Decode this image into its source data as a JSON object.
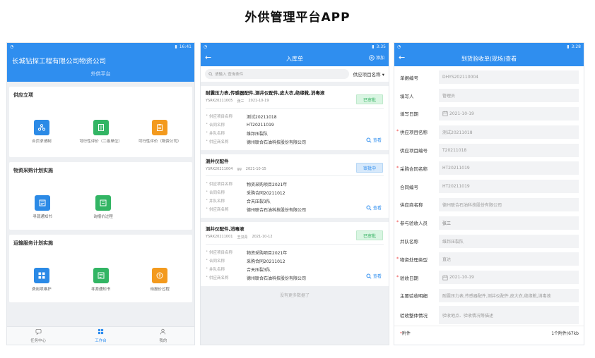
{
  "page_title": "外供管理平台APP",
  "colors": {
    "primary": "#2f8eef",
    "success": "#32b564",
    "warning": "#f39a1e"
  },
  "phone1": {
    "status_time": "16:41",
    "org_name": "长城钻探工程有限公司物资公司",
    "platform": "外供平台",
    "sections": [
      {
        "title": "供应立项",
        "items": [
          {
            "label": "合页求请制",
            "icon": "users-icon",
            "color": "blue"
          },
          {
            "label": "可行性评价（二级单位）",
            "icon": "document-icon",
            "color": "green"
          },
          {
            "label": "可行性评价（物资公司）",
            "icon": "clipboard-icon",
            "color": "orange"
          }
        ]
      },
      {
        "title": "物资采购计划实施",
        "items": [
          {
            "label": "寻源通知书",
            "icon": "notice-icon",
            "color": "blue"
          },
          {
            "label": "询报价过程",
            "icon": "quote-icon",
            "color": "green"
          }
        ]
      },
      {
        "title": "运输服务计划实施",
        "items": [
          {
            "label": "费用项维护",
            "icon": "grid-icon",
            "color": "blue"
          },
          {
            "label": "寻源通知书",
            "icon": "notice-icon",
            "color": "green"
          },
          {
            "label": "询报价过程",
            "icon": "coin-icon",
            "color": "orange"
          }
        ]
      }
    ],
    "tabs": [
      {
        "label": "任务中心",
        "icon": "chat-icon"
      },
      {
        "label": "工作台",
        "icon": "grid-icon"
      },
      {
        "label": "我的",
        "icon": "user-icon"
      }
    ]
  },
  "phone2": {
    "status_time": "3:35",
    "title": "入库单",
    "add_label": "添加",
    "search_placeholder": "请输入 查询条件",
    "filter_label": "供应项目名称",
    "field_labels": [
      "供应项目名称",
      "合同名称",
      "井队名称",
      "供应商名称"
    ],
    "view_label": "查看",
    "no_more": "没有更多数据了",
    "records": [
      {
        "title": "耐震压力表,传感器配件,测井仪配件,皮大衣,绝缘靴,消毒液",
        "code": "YSRK20211005",
        "person": "张三",
        "date": "2021-10-19",
        "status": "已审批",
        "status_type": "done",
        "values": [
          "测试20211018",
          "HT20211019",
          "维邦压裂队",
          "德州联合石油科技股份有限公司"
        ]
      },
      {
        "title": "测井仪配件",
        "code": "YSRK20211004",
        "person": "gg",
        "date": "2021-10-15",
        "status": "审批中",
        "status_type": "review",
        "values": [
          "物资采购项目2021年",
          "采购合同20211012",
          "合天压裂3队",
          "德州联合石油科技股份有限公司"
        ]
      },
      {
        "title": "测井仪配件,消毒液",
        "code": "YSRK20211001",
        "person": "王汉青",
        "date": "2021-10-12",
        "status": "已审批",
        "status_type": "done",
        "values": [
          "物资采购项目2021年",
          "采购合同20211012",
          "合天压裂3队",
          "德州联合石油科技股份有限公司"
        ]
      }
    ]
  },
  "phone3": {
    "status_time": "3:28",
    "title": "到货验收单(现场)查看",
    "rows": [
      {
        "label": "单据编号",
        "value": "DHYS202110004",
        "required": false
      },
      {
        "label": "填写人",
        "value": "管理员",
        "required": false
      },
      {
        "label": "填写日期",
        "value": "2021-10-19",
        "required": false,
        "date": true
      },
      {
        "label": "供应项目名称",
        "value": "测试20211018",
        "required": true
      },
      {
        "label": "供应项目编号",
        "value": "T20211018",
        "required": false
      },
      {
        "label": "采购合同名称",
        "value": "HT20211019",
        "required": true
      },
      {
        "label": "合同编号",
        "value": "HT20211019",
        "required": false
      },
      {
        "label": "供应商名称",
        "value": "德州联合石油科技股份有限公司",
        "required": false
      },
      {
        "label": "参与验收人员",
        "value": "张三",
        "required": true,
        "dark": true
      },
      {
        "label": "井队名称",
        "value": "维邦压裂队",
        "required": false
      },
      {
        "label": "物资处理类型",
        "value": "直达",
        "required": true
      },
      {
        "label": "验收日期",
        "value": "2021-10-19",
        "required": true,
        "date": true
      },
      {
        "label": "主要验收明细",
        "value": "耐震压力表,传感器配件,测井仪配件,皮大衣,绝缘靴,消毒液",
        "required": false
      },
      {
        "label": "验收整体情况",
        "value": "验收地点、验收情况等描述",
        "required": false,
        "tall": true
      }
    ],
    "attachment_label": "附件",
    "attachment_info": "1个附件/67kb"
  }
}
